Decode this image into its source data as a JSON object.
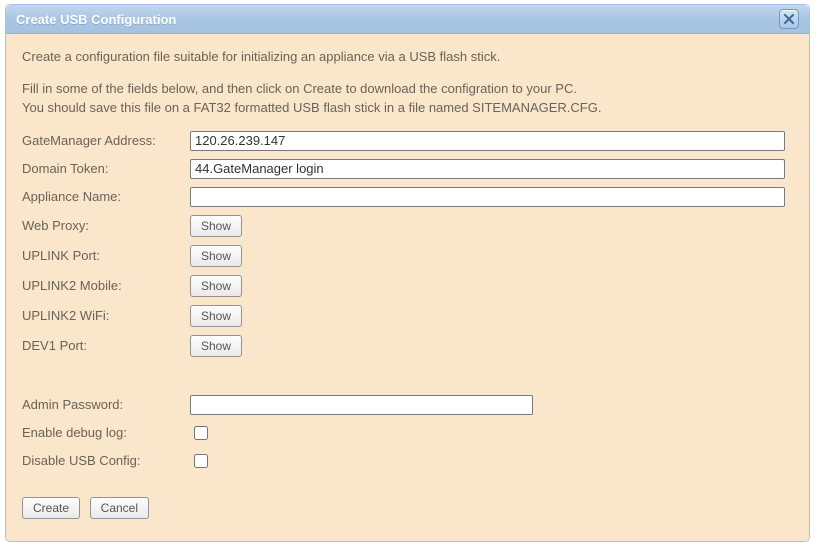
{
  "dialog": {
    "title": "Create USB Configuration",
    "close_label": "Close"
  },
  "intro": {
    "line1": "Create a configuration file suitable for initializing an appliance via a USB flash stick.",
    "line2": "Fill in some of the fields below, and then click on Create to download the configration to your PC.",
    "line3": "You should save this file on a FAT32 formatted USB flash stick in a file named SITEMANAGER.CFG."
  },
  "form": {
    "gatemanager_address": {
      "label": "GateManager Address:",
      "value": "120.26.239.147"
    },
    "domain_token": {
      "label": "Domain Token:",
      "value": "44.GateManager login"
    },
    "appliance_name": {
      "label": "Appliance Name:",
      "value": ""
    },
    "web_proxy": {
      "label": "Web Proxy:",
      "button": "Show"
    },
    "uplink_port": {
      "label": "UPLINK Port:",
      "button": "Show"
    },
    "uplink2_mobile": {
      "label": "UPLINK2 Mobile:",
      "button": "Show"
    },
    "uplink2_wifi": {
      "label": "UPLINK2 WiFi:",
      "button": "Show"
    },
    "dev1_port": {
      "label": "DEV1 Port:",
      "button": "Show"
    },
    "admin_password": {
      "label": "Admin Password:",
      "value": ""
    },
    "enable_debug_log": {
      "label": "Enable debug log:",
      "checked": false
    },
    "disable_usb_config": {
      "label": "Disable USB Config:",
      "checked": false
    }
  },
  "actions": {
    "create": "Create",
    "cancel": "Cancel"
  }
}
